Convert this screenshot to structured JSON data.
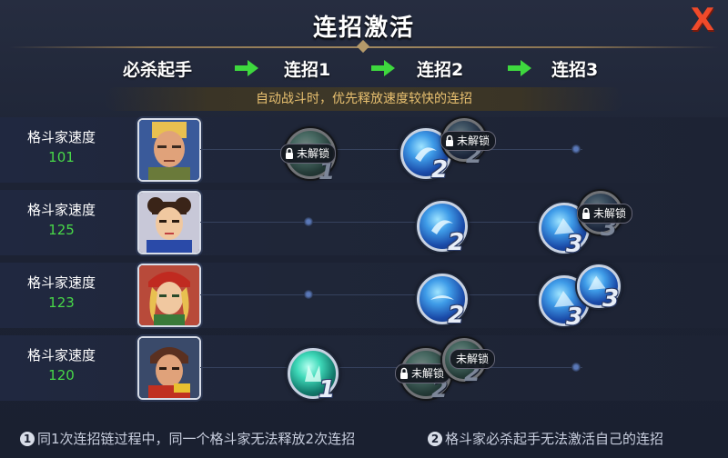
{
  "title": "连招激活",
  "close_glyph": "X",
  "chain_headers": [
    "必杀起手",
    "连招1",
    "连招2",
    "连招3"
  ],
  "hint": "自动战斗时，优先释放速度较快的连招",
  "rows": [
    {
      "label": "格斗家速度",
      "speed": "101"
    },
    {
      "label": "格斗家速度",
      "speed": "125"
    },
    {
      "label": "格斗家速度",
      "speed": "123"
    },
    {
      "label": "格斗家速度",
      "speed": "120"
    }
  ],
  "skills": {
    "r1_c1": {
      "number": "1",
      "lock_label": "未解锁"
    },
    "r1_c2a": {
      "number": "2"
    },
    "r1_c2b": {
      "number": "2",
      "lock_label": "未解锁"
    },
    "r2_c2": {
      "number": "2"
    },
    "r2_c3a": {
      "number": "3"
    },
    "r2_c3b": {
      "number": "3",
      "lock_label": "未解锁"
    },
    "r3_c2": {
      "number": "2"
    },
    "r3_c3a": {
      "number": "3"
    },
    "r3_c3b": {
      "number": "3"
    },
    "r4_c1": {
      "number": "1"
    },
    "r4_c2a": {
      "number": "2",
      "lock_label": "未解锁"
    },
    "r4_c2b": {
      "number": "2",
      "lock_label": "未解锁"
    }
  },
  "footer": {
    "note1_marker": "1",
    "note1": "同1次连招链过程中，同一个格斗家无法释放2次连招",
    "note2_marker": "2",
    "note2": "格斗家必杀起手无法激活自己的连招"
  },
  "colors": {
    "speed": "#48d848",
    "hint": "#e8c070",
    "close": "#f04a2a",
    "arrow": "#3ed83e"
  }
}
